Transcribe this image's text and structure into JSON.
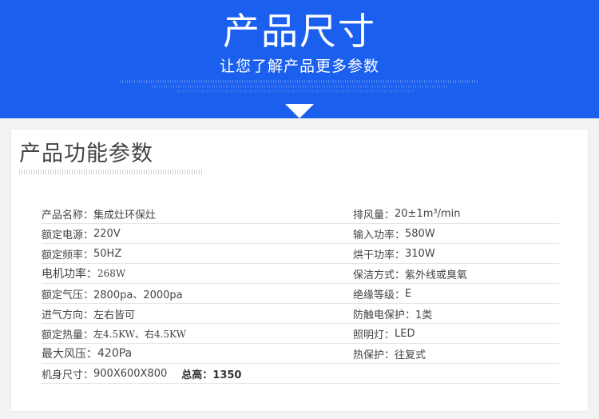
{
  "banner": {
    "title": "产品尺寸",
    "subtitle": "让您了解产品更多参数"
  },
  "section": {
    "title": "产品功能参数"
  },
  "specs": {
    "left": [
      {
        "label": "产品名称：",
        "value": "集成灶环保灶"
      },
      {
        "label": "额定电源：",
        "value": "220V"
      },
      {
        "label": "额定频率：",
        "value": "50HZ"
      },
      {
        "label": "电机功率：",
        "value": "268W"
      },
      {
        "label": "额定气压：",
        "value": "2800pa、2000pa"
      },
      {
        "label": "进气方向：",
        "value": "左右皆可"
      },
      {
        "label": "额定热量：",
        "value": "左4.5KW、右4.5KW"
      },
      {
        "label": "最大风压：",
        "value": "420Pa"
      },
      {
        "label": "机身尺寸：",
        "value": "900X600X800",
        "extra": "总高：1350"
      }
    ],
    "right": [
      {
        "label": "排风量：",
        "value": "20±1m³/min"
      },
      {
        "label": "输入功率：",
        "value": "580W"
      },
      {
        "label": "烘干功率：",
        "value": "310W"
      },
      {
        "label": "保洁方式：",
        "value": "紫外线或臭氧"
      },
      {
        "label": "绝缘等级：",
        "value": "E"
      },
      {
        "label": "防触电保护：",
        "value": "1类"
      },
      {
        "label": "照明灯：",
        "value": "LED"
      },
      {
        "label": "热保护：",
        "value": "往复式"
      },
      {
        "label": "",
        "value": ""
      }
    ]
  }
}
